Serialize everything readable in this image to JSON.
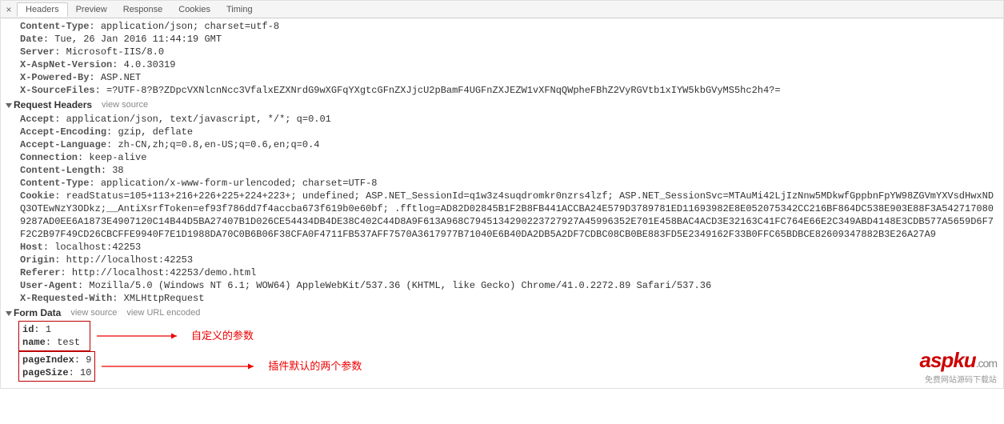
{
  "tabs": {
    "close": "×",
    "items": [
      "Headers",
      "Preview",
      "Response",
      "Cookies",
      "Timing"
    ]
  },
  "response_headers": [
    {
      "k": "Content-Type",
      "v": "application/json; charset=utf-8"
    },
    {
      "k": "Date",
      "v": "Tue, 26 Jan 2016 11:44:19 GMT"
    },
    {
      "k": "Server",
      "v": "Microsoft-IIS/8.0"
    },
    {
      "k": "X-AspNet-Version",
      "v": "4.0.30319"
    },
    {
      "k": "X-Powered-By",
      "v": "ASP.NET"
    },
    {
      "k": "X-SourceFiles",
      "v": "=?UTF-8?B?ZDpcVXNlcnNcc3VfalxEZXNrdG9wXGFqYXgtcGFnZXJjcU2pBamF4UGFnZXJEZW1vXFNqQWpheFBhZ2VyRGVtb1xIYW5kbGVyMS5hc2h4?="
    }
  ],
  "request_section": {
    "title": "Request Headers",
    "view_source": "view source"
  },
  "request_headers": [
    {
      "k": "Accept",
      "v": "application/json, text/javascript, */*; q=0.01"
    },
    {
      "k": "Accept-Encoding",
      "v": "gzip, deflate"
    },
    {
      "k": "Accept-Language",
      "v": "zh-CN,zh;q=0.8,en-US;q=0.6,en;q=0.4"
    },
    {
      "k": "Connection",
      "v": "keep-alive"
    },
    {
      "k": "Content-Length",
      "v": "38"
    },
    {
      "k": "Content-Type",
      "v": "application/x-www-form-urlencoded; charset=UTF-8"
    },
    {
      "k": "Cookie",
      "v": "readStatus=105+113+216+226+225+224+223+; undefined; ASP.NET_SessionId=q1w3z4suqdromkr0nzrs4lzf; ASP.NET_SessionSvc=MTAuMi42LjIzNnw5MDkwfGppbnFpYW98ZGVmYXVsdHwxNDQ3OTEwNzY3ODkz;__AntiXsrfToken=ef93f786dd7f4accba673f619b0e60bf; .fftlog=AD82D02845B1F2B8FB441ACCBA24E579D3789781ED11693982E8E052075342CC216BF864DC538E903E88F3A5427170809287AD0EE6A1873E4907120C14B44D5BA27407B1D026CE54434DB4DE38C402C44D8A9F613A968C7945134290223727927A45996352E701E458BAC4ACD3E32163C41FC764E66E2C349ABD4148E3CDB577A5659D6F7F2C2B97F49CD26CBCFFE9940F7E1D1988DA70C0B6B06F38CFA0F4711FB537AFF7570A3617977B71040E6B40DA2DB5A2DF7CDBC08CB0BE883FD5E2349162F33B0FFC65BDBCE82609347882B3E26A27A9"
    },
    {
      "k": "Host",
      "v": "localhost:42253"
    },
    {
      "k": "Origin",
      "v": "http://localhost:42253"
    },
    {
      "k": "Referer",
      "v": "http://localhost:42253/demo.html"
    },
    {
      "k": "User-Agent",
      "v": "Mozilla/5.0 (Windows NT 6.1; WOW64) AppleWebKit/537.36 (KHTML, like Gecko) Chrome/41.0.2272.89 Safari/537.36"
    },
    {
      "k": "X-Requested-With",
      "v": "XMLHttpRequest"
    }
  ],
  "form_section": {
    "title": "Form Data",
    "view_source": "view source",
    "view_url": "view URL encoded"
  },
  "form_data": {
    "custom": [
      {
        "k": "id",
        "v": "1"
      },
      {
        "k": "name",
        "v": "test"
      }
    ],
    "default": [
      {
        "k": "pageIndex",
        "v": "9"
      },
      {
        "k": "pageSize",
        "v": "10"
      }
    ]
  },
  "annotations": {
    "custom": "自定义的参数",
    "default": "插件默认的两个参数"
  },
  "watermark": {
    "brand_a": "asp",
    "brand_b": "ku",
    "brand_c": ".com",
    "sub": "免费网站源码下载站"
  }
}
